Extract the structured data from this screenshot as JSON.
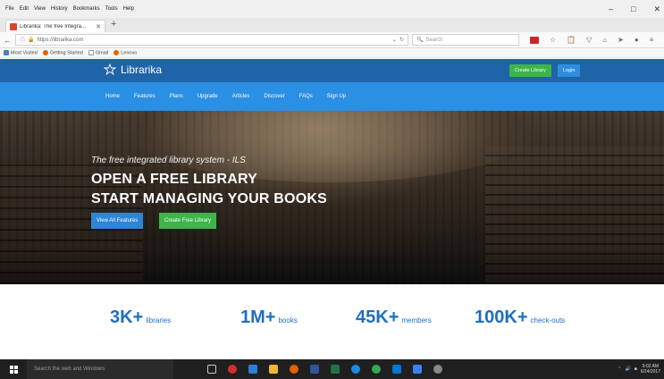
{
  "browser": {
    "menu": [
      "File",
      "Edit",
      "View",
      "History",
      "Bookmarks",
      "Tools",
      "Help"
    ],
    "window_controls": [
      "–",
      "□",
      "✕"
    ],
    "tab_title": "Librarika: The free Integra...",
    "tab_close": "✕",
    "new_tab": "+",
    "url": "https://librarika.com",
    "search_placeholder": "Search",
    "bookmarks": [
      "Most Visited",
      "Getting Started",
      "Gmail",
      "Lenovo"
    ]
  },
  "site": {
    "logo_text": "Librarika",
    "create_library_label": "Create Library",
    "login_label": "Login",
    "nav": [
      "Home",
      "Features",
      "Plans",
      "Upgrade",
      "Articles",
      "Discover",
      "FAQs",
      "Sign Up"
    ]
  },
  "hero": {
    "subtitle": "The free integrated library system - ILS",
    "line1": "OPEN A FREE LIBRARY",
    "line2": "START MANAGING YOUR BOOKS",
    "btn_features": "View All Features",
    "btn_free": "Create Free Library"
  },
  "stats": [
    {
      "value": "3K+",
      "label": "libraries"
    },
    {
      "value": "1M+",
      "label": "books"
    },
    {
      "value": "45K+",
      "label": "members"
    },
    {
      "value": "100K+",
      "label": "check-outs"
    }
  ],
  "taskbar": {
    "search_placeholder": "Search the web and Windows",
    "time": "9:02 AM",
    "date": "6/24/2017"
  },
  "colors": {
    "site_header": "#1f64a8",
    "site_nav": "#2b8fe4",
    "accent_green": "#3cb54a",
    "stat_blue": "#1e6fc2"
  }
}
